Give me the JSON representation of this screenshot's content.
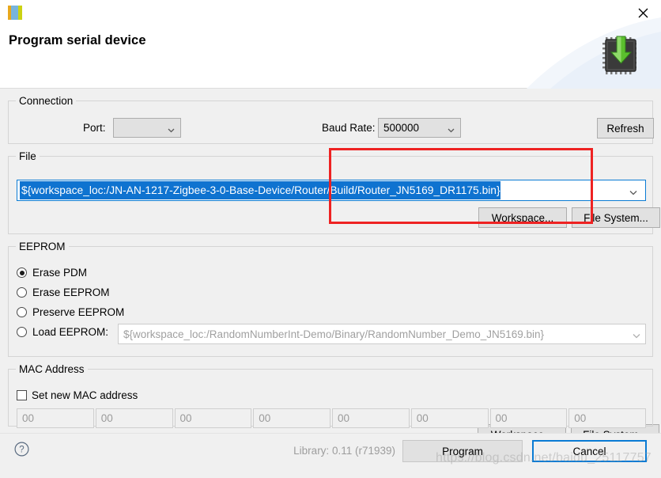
{
  "window": {
    "title": "Program serial device",
    "app_icon": "serial-device-icon",
    "close_icon": "close-icon",
    "header_icon": "chip-download-icon"
  },
  "connection": {
    "legend": "Connection",
    "port_label": "Port:",
    "port_value": "",
    "baud_label": "Baud Rate:",
    "baud_value": "500000",
    "refresh_label": "Refresh"
  },
  "file": {
    "legend": "File",
    "path": "${workspace_loc:/JN-AN-1217-Zigbee-3-0-Base-Device/Router/Build/Router_JN5169_DR1175.bin}",
    "workspace_label": "Workspace...",
    "filesystem_label": "File System..."
  },
  "eeprom": {
    "legend": "EEPROM",
    "options": [
      {
        "label": "Erase PDM",
        "selected": true
      },
      {
        "label": "Erase EEPROM",
        "selected": false
      },
      {
        "label": "Preserve EEPROM",
        "selected": false
      },
      {
        "label": "Load EEPROM:",
        "selected": false
      }
    ],
    "load_path": "${workspace_loc:/RandomNumberInt-Demo/Binary/RandomNumber_Demo_JN5169.bin}",
    "workspace_label": "Workspace...",
    "filesystem_label": "File System..."
  },
  "mac": {
    "legend": "MAC Address",
    "checkbox_label": "Set new MAC address",
    "checked": false,
    "octets": [
      "00",
      "00",
      "00",
      "00",
      "00",
      "00",
      "00",
      "00"
    ]
  },
  "footer": {
    "help_icon": "help-icon",
    "library_text": "Library: 0.11 (r71939)",
    "program_label": "Program",
    "cancel_label": "Cancel"
  },
  "annotation": {
    "highlight_color": "#ee2222"
  },
  "watermark": {
    "text": "https://blog.csdn.net/baidu_25117757"
  }
}
